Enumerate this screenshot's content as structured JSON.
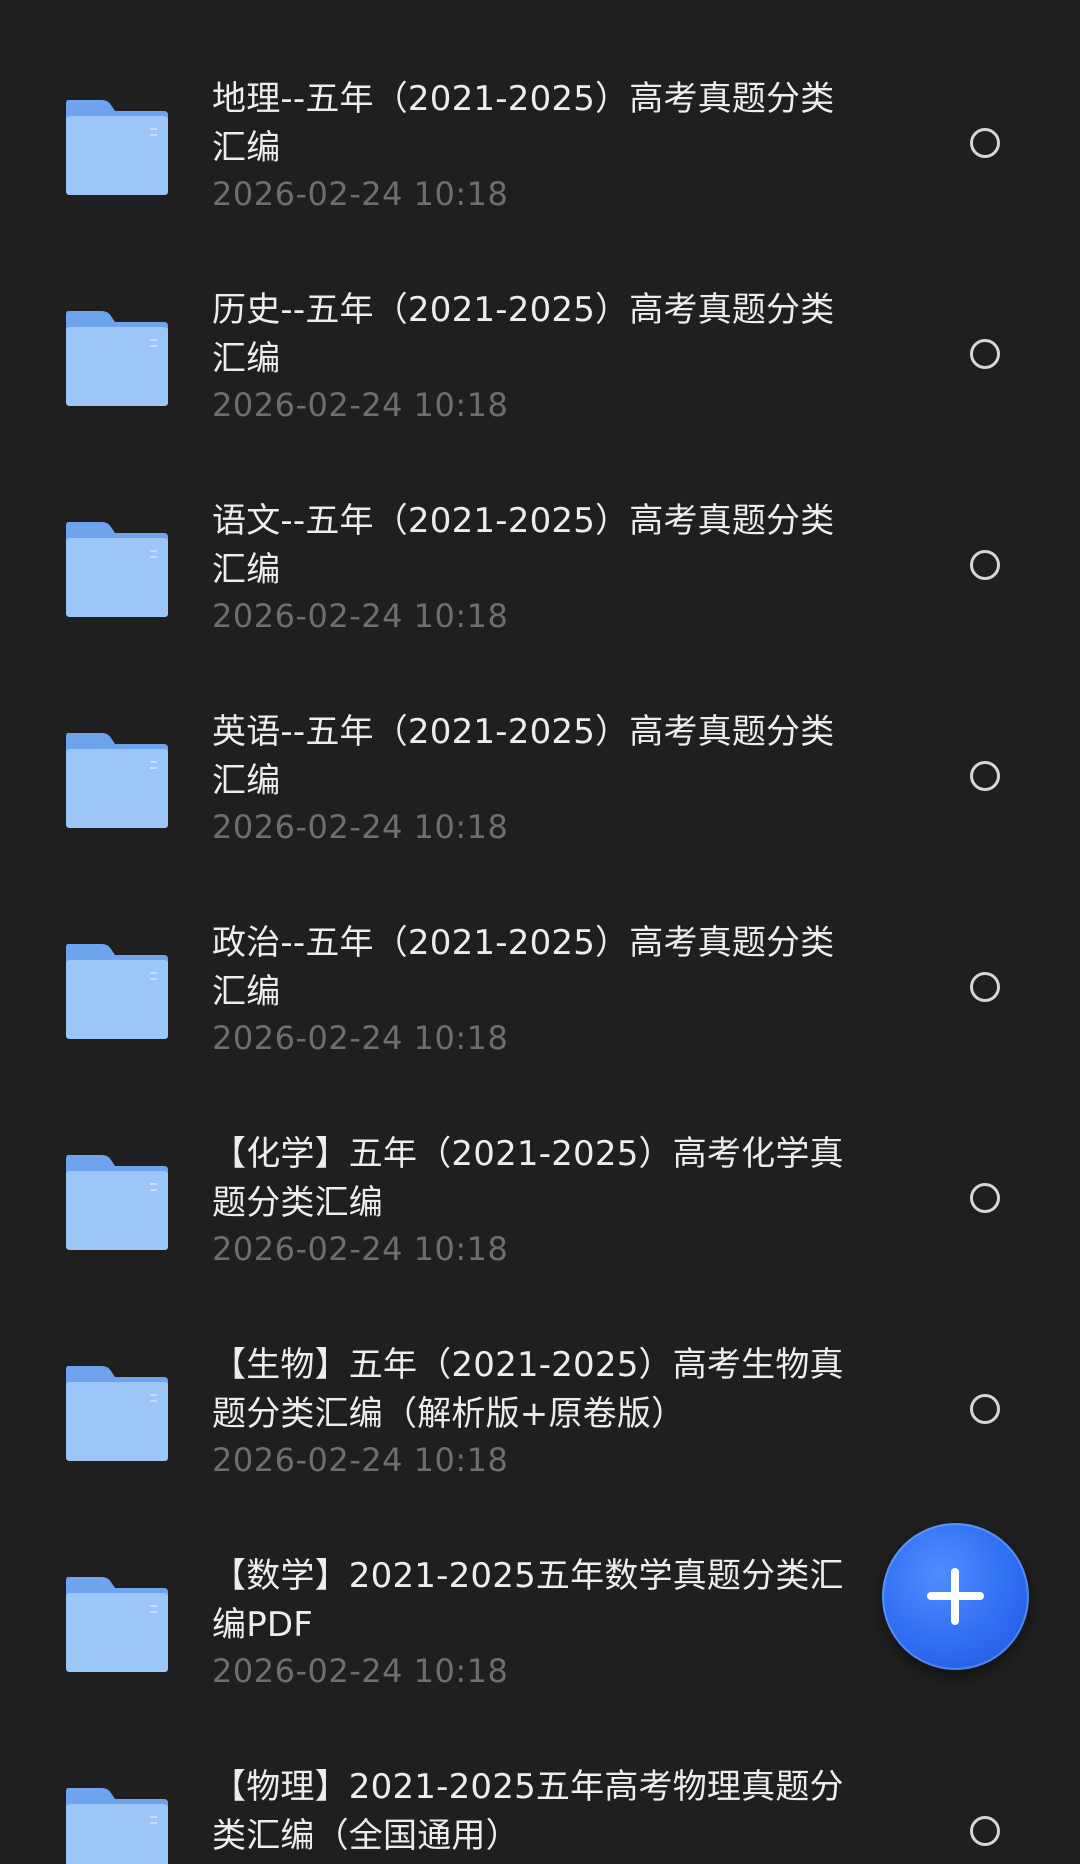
{
  "files": [
    {
      "title": "地理--五年（2021-2025）高考真题分类汇编",
      "date": "2026-02-24 10:18"
    },
    {
      "title": "历史--五年（2021-2025）高考真题分类汇编",
      "date": "2026-02-24 10:18"
    },
    {
      "title": "语文--五年（2021-2025）高考真题分类汇编",
      "date": "2026-02-24 10:18"
    },
    {
      "title": "英语--五年（2021-2025）高考真题分类汇编",
      "date": "2026-02-24 10:18"
    },
    {
      "title": "政治--五年（2021-2025）高考真题分类汇编",
      "date": "2026-02-24 10:18"
    },
    {
      "title": "【化学】五年（2021-2025）高考化学真题分类汇编",
      "date": "2026-02-24 10:18"
    },
    {
      "title": "【生物】五年（2021-2025）高考生物真题分类汇编（解析版+原卷版）",
      "date": "2026-02-24 10:18"
    },
    {
      "title": "【数学】2021-2025五年数学真题分类汇编PDF",
      "date": "2026-02-24 10:18"
    },
    {
      "title": "【物理】2021-2025五年高考物理真题分类汇编（全国通用）",
      "date": ""
    }
  ],
  "icons": {
    "folder": "folder-icon",
    "select": "radio-unchecked-icon",
    "add": "plus-icon"
  },
  "colors": {
    "background": "#1f1f1f",
    "folder": "#8fbcf6",
    "accent": "#2f6df2"
  }
}
